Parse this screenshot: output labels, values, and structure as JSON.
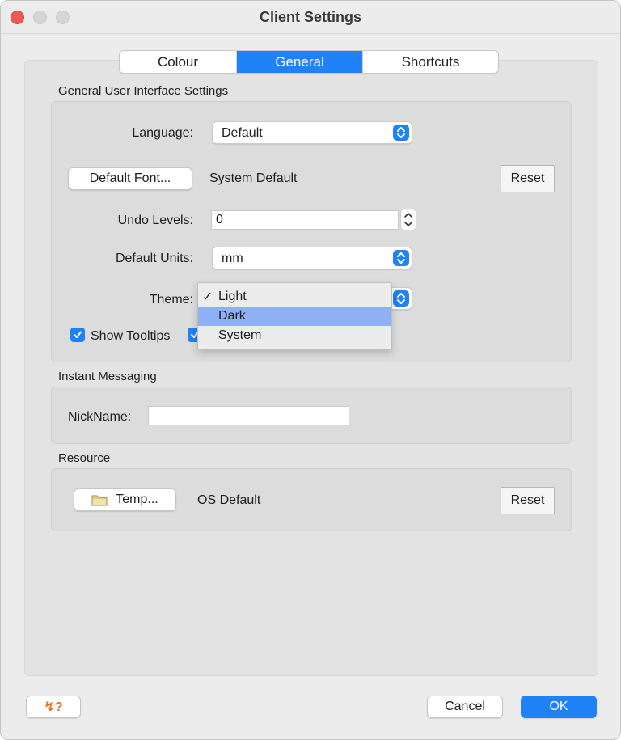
{
  "window": {
    "title": "Client Settings"
  },
  "tabs": [
    {
      "label": "Colour",
      "selected": false
    },
    {
      "label": "General",
      "selected": true
    },
    {
      "label": "Shortcuts",
      "selected": false
    }
  ],
  "general_ui": {
    "section_title": "General User Interface Settings",
    "language_label": "Language:",
    "language_value": "Default",
    "default_font_button": "Default Font...",
    "font_value": "System Default",
    "font_reset": "Reset",
    "undo_label": "Undo Levels:",
    "undo_value": "0",
    "units_label": "Default Units:",
    "units_value": "mm",
    "theme_label": "Theme:",
    "show_tooltips_label": "Show Tooltips",
    "show_tooltips_checked": true,
    "second_checkbox_checked": true
  },
  "theme_menu": {
    "items": [
      {
        "label": "Light",
        "checked": true,
        "highlighted": false
      },
      {
        "label": "Dark",
        "checked": false,
        "highlighted": true
      },
      {
        "label": "System",
        "checked": false,
        "highlighted": false
      }
    ],
    "check_glyph": "✓"
  },
  "instant_messaging": {
    "section_title": "Instant Messaging",
    "nickname_label": "NickName:",
    "nickname_value": ""
  },
  "resource": {
    "section_title": "Resource",
    "temp_button": "Temp...",
    "path_value": "OS Default",
    "reset_label": "Reset"
  },
  "footer": {
    "help_glyph": "↯?",
    "cancel_label": "Cancel",
    "ok_label": "OK"
  },
  "colors": {
    "accent": "#1f82f6",
    "menu_highlight": "#8db1f4",
    "help_icon": "#e8711c"
  }
}
